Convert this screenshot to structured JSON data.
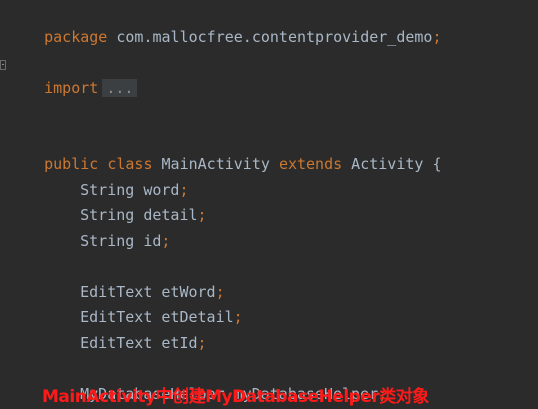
{
  "code": {
    "package_kw": "package",
    "package_name": " com.mallocfree.contentprovider_demo",
    "semicolon": ";",
    "import_kw": "import",
    "import_folded": "...",
    "public_kw": "public",
    "class_kw": "class",
    "class_name": " MainActivity ",
    "extends_kw": "extends",
    "parent_class": " Activity {",
    "field_word": "String word",
    "field_detail": "String detail",
    "field_id": "String id",
    "field_etword": "EditText etWord",
    "field_etdetail": "EditText etDetail",
    "field_etid": "EditText etId",
    "field_helper": "MyDatabaseHelper myDatabaseHelper"
  },
  "annotation": {
    "text": "MainActivity中创建MyDatabaseHelper类对象"
  },
  "colors": {
    "background": "#2b2b2b",
    "keyword": "#cc7832",
    "text": "#a9b7c6",
    "annotation": "#ff1a1a"
  }
}
